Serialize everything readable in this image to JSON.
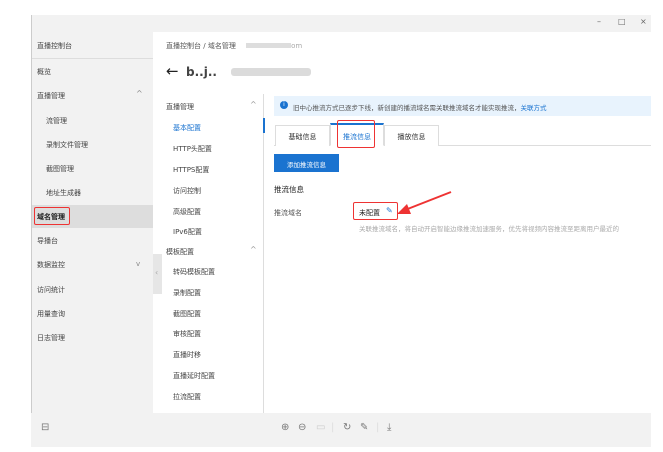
{
  "window": {
    "minimize": "–",
    "maximize": "□",
    "close": "×"
  },
  "sidebar": {
    "title": "直播控制台",
    "items": [
      {
        "label": "概览"
      },
      {
        "label": "直播管理"
      },
      {
        "label": "流管理"
      },
      {
        "label": "录制文件管理"
      },
      {
        "label": "截图管理"
      },
      {
        "label": "地址生成器"
      },
      {
        "label": "域名管理"
      },
      {
        "label": "导播台"
      },
      {
        "label": "数据监控"
      },
      {
        "label": "访问统计"
      },
      {
        "label": "用量查询"
      },
      {
        "label": "日志管理"
      }
    ]
  },
  "breadcrumb": {
    "root": "直播控制台",
    "sep": "/",
    "current": "域名管理",
    "domain": "om"
  },
  "page": {
    "back": "←",
    "title": "b..j.."
  },
  "submenu": {
    "groups": [
      {
        "label": "直播管理",
        "items": [
          "基本配置",
          "HTTP头配置",
          "HTTPS配置",
          "访问控制",
          "高级配置",
          "IPv6配置"
        ]
      },
      {
        "label": "模板配置",
        "items": [
          "转码模板配置",
          "录制配置",
          "截图配置",
          "审核配置",
          "直播时移",
          "直播延时配置",
          "拉流配置"
        ]
      }
    ]
  },
  "notice": {
    "text": "旧中心推流方式已逐步下线，新创建的播流域名需关联推流域名才能实现推流，",
    "link": "关联方式"
  },
  "tabs": [
    "基础信息",
    "推流信息",
    "播放信息"
  ],
  "add_button": "添加推流信息",
  "section_title": "推流信息",
  "field": {
    "label": "推流域名",
    "value": "未配置",
    "hint": "关联推流域名，将自动开启智能边缘推流加速服务，优先将视频内容推流至距离用户最近的"
  },
  "colors": {
    "accent": "#1a73d0",
    "highlight": "#e33"
  }
}
